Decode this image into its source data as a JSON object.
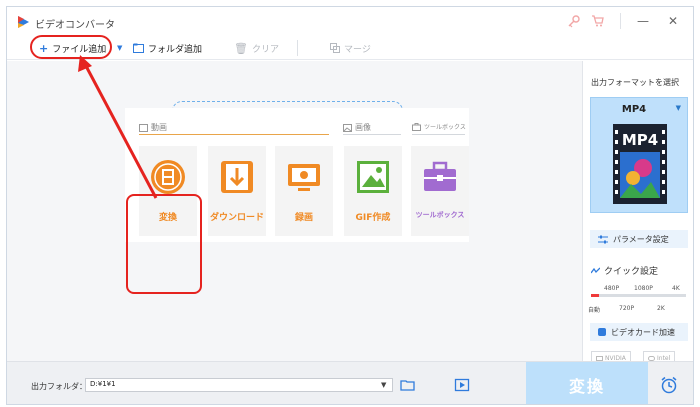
{
  "window": {
    "title": "ビデオコンバータ",
    "minimize": "—",
    "close": "✕"
  },
  "toolbar": {
    "add_file": "ファイル追加",
    "add_folder": "フォルダ追加",
    "clear": "クリア",
    "merge": "マージ"
  },
  "categories": {
    "video": "動画",
    "image": "画像",
    "toolbox": "ツールボックス"
  },
  "tiles": [
    {
      "label": "変換",
      "icon": "film-convert-icon"
    },
    {
      "label": "ダウンロード",
      "icon": "download-icon"
    },
    {
      "label": "録画",
      "icon": "screen-record-icon"
    },
    {
      "label": "GIF作成",
      "icon": "gif-image-icon"
    },
    {
      "label": "ツールボックス",
      "icon": "toolbox-icon"
    }
  ],
  "sidepanel": {
    "title": "出力フォーマットを選択",
    "format": "MP4",
    "format_badge": "MP4",
    "param_settings": "パラメータ設定",
    "quick_settings": "クイック設定",
    "quality_top": [
      "480P",
      "1080P",
      "4K"
    ],
    "quality_bottom": [
      "自動",
      "720P",
      "2K"
    ],
    "gpu_accel": "ビデオカード加速",
    "gpu_nvidia": "NVIDIA",
    "gpu_intel": "Intel"
  },
  "bottom": {
    "output_folder_label": "出力フォルダ：",
    "output_folder_value": "D:¥1¥1",
    "convert": "変換"
  },
  "colors": {
    "accent_orange": "#f08a24",
    "highlight_red": "#e5231f",
    "format_card_bg": "#bfe0fb",
    "convert_button": "#bde0fb"
  }
}
